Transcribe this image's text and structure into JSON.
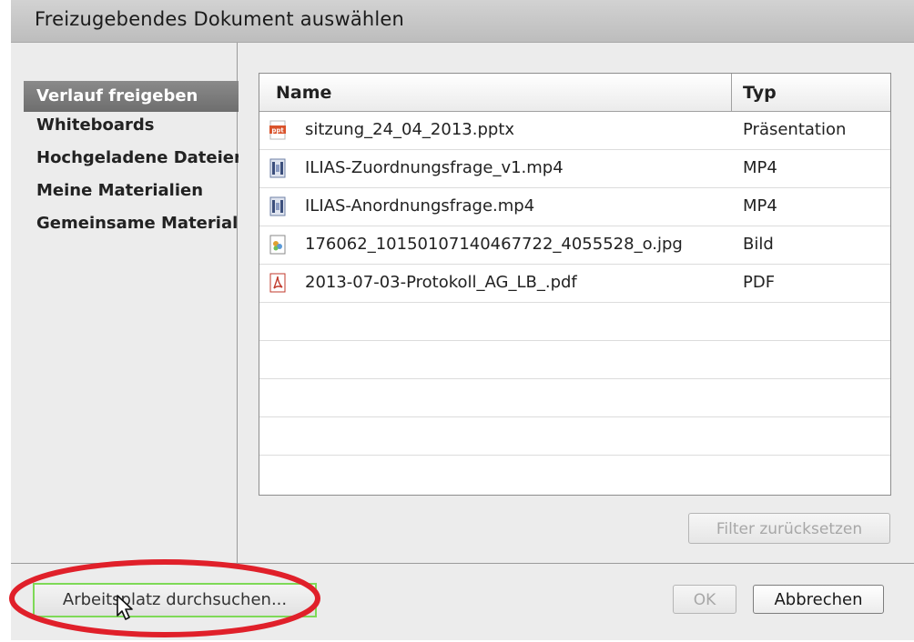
{
  "window": {
    "title": "Freizugebendes Dokument auswählen"
  },
  "sidebar": {
    "items": [
      {
        "label": "Verlauf freigeben",
        "active": true
      },
      {
        "label": "Whiteboards",
        "active": false
      },
      {
        "label": "Hochgeladene Dateien",
        "active": false
      },
      {
        "label": "Meine Materialien",
        "active": false
      },
      {
        "label": "Gemeinsame Materialien",
        "active": false
      }
    ]
  },
  "table": {
    "columns": {
      "name": "Name",
      "type": "Typ"
    },
    "rows": [
      {
        "name": "sitzung_24_04_2013.pptx",
        "type": "Präsentation",
        "icon": "ppt-file-icon"
      },
      {
        "name": "ILIAS-Zuordnungsfrage_v1.mp4",
        "type": "MP4",
        "icon": "video-file-icon"
      },
      {
        "name": "ILIAS-Anordnungsfrage.mp4",
        "type": "MP4",
        "icon": "video-file-icon"
      },
      {
        "name": "176062_10150107140467722_4055528_o.jpg",
        "type": "Bild",
        "icon": "image-file-icon"
      },
      {
        "name": "2013-07-03-Protokoll_AG_LB_.pdf",
        "type": "PDF",
        "icon": "pdf-file-icon"
      }
    ]
  },
  "buttons": {
    "filter_reset": "Filter zurücksetzen",
    "browse": "Arbeitsplatz durchsuchen...",
    "ok": "OK",
    "cancel": "Abbrechen"
  },
  "colors": {
    "annotation": "#e0202a",
    "highlight": "#7ed957",
    "active_item": "#7a7a7a"
  }
}
